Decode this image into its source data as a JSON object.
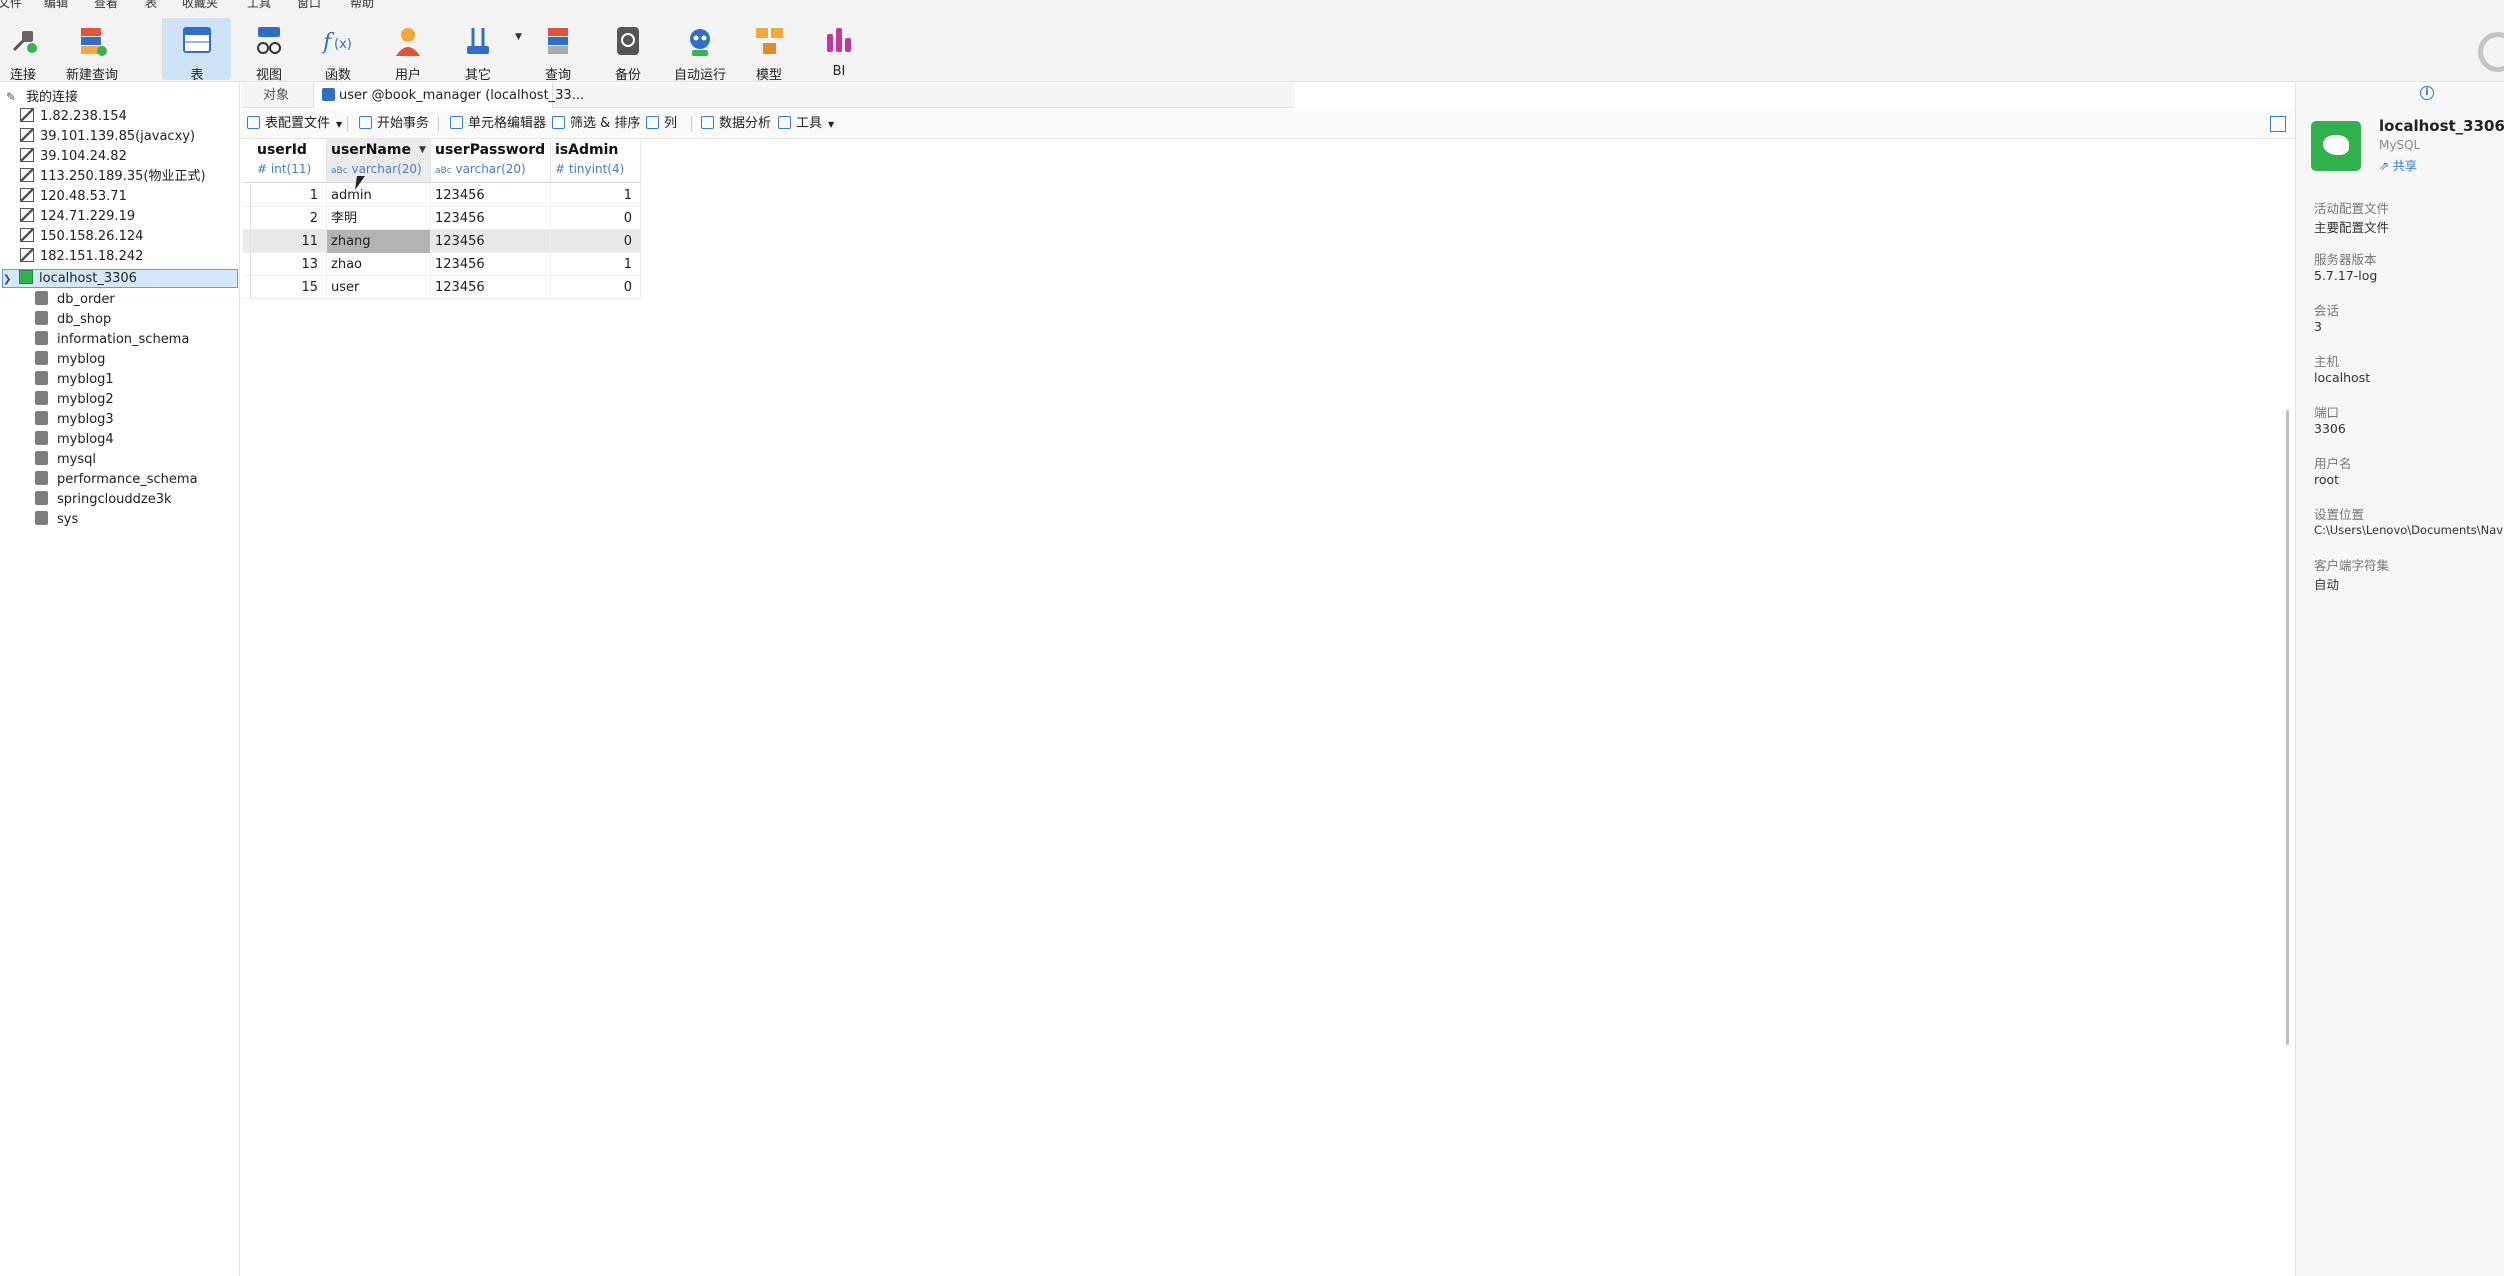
{
  "menu": [
    "文件",
    "编辑",
    "查看",
    "表",
    "收藏夹",
    "工具",
    "窗口",
    "帮助"
  ],
  "toolbar": [
    {
      "label": "连接",
      "icon": "plug-icon"
    },
    {
      "label": "新建查询",
      "icon": "new-query-icon"
    },
    {
      "label": "表",
      "icon": "table-icon"
    },
    {
      "label": "视图",
      "icon": "view-glasses-icon"
    },
    {
      "label": "函数",
      "icon": "function-icon"
    },
    {
      "label": "用户",
      "icon": "user-icon"
    },
    {
      "label": "其它",
      "icon": "tools-icon"
    },
    {
      "label": "查询",
      "icon": "query-icon"
    },
    {
      "label": "备份",
      "icon": "backup-icon"
    },
    {
      "label": "自动运行",
      "icon": "robot-icon"
    },
    {
      "label": "模型",
      "icon": "model-icon"
    },
    {
      "label": "BI",
      "icon": "bi-chart-icon"
    }
  ],
  "colors": {
    "accent": "#2e75d1",
    "connection_green": "#31b14b",
    "active_toolbar": "#cfe3f7"
  },
  "navigator": {
    "root": "我的连接",
    "connections": [
      "1.82.238.154",
      "39.101.139.85(javacxy)",
      "39.104.24.82",
      "113.250.189.35(物业正式)",
      "120.48.53.71",
      "124.71.229.19",
      "150.158.26.124",
      "182.151.18.242"
    ],
    "active_connection": "localhost_3306",
    "databases": [
      "db_order",
      "db_shop",
      "information_schema",
      "myblog",
      "myblog1",
      "myblog2",
      "myblog3",
      "myblog4",
      "mysql",
      "performance_schema",
      "springclouddze3k",
      "sys"
    ]
  },
  "tabs": {
    "objects": "对象",
    "active": "user @book_manager (localhost_33..."
  },
  "subtoolbar": {
    "profile": "表配置文件",
    "begin_tx": "开始事务",
    "cell_editor": "单元格编辑器",
    "filter_sort": "筛选 & 排序",
    "columns": "列",
    "analysis": "数据分析",
    "tools": "工具"
  },
  "grid": {
    "columns": [
      {
        "name": "userId",
        "type": "int(11)",
        "type_icon": "#"
      },
      {
        "name": "userName",
        "type": "varchar(20)",
        "type_icon": "aBc"
      },
      {
        "name": "userPassword",
        "type": "varchar(20)",
        "type_icon": "aBc"
      },
      {
        "name": "isAdmin",
        "type": "tinyint(4)",
        "type_icon": "#"
      }
    ],
    "rows": [
      [
        "1",
        "admin",
        "123456",
        "1"
      ],
      [
        "2",
        "李明",
        "123456",
        "0"
      ],
      [
        "11",
        "zhang",
        "123456",
        "0"
      ],
      [
        "13",
        "zhao",
        "123456",
        "1"
      ],
      [
        "15",
        "user",
        "123456",
        "0"
      ]
    ]
  },
  "info": {
    "name": "localhost_3306",
    "type": "MySQL",
    "share": "共享",
    "fields": [
      {
        "label": "活动配置文件",
        "value": "主要配置文件"
      },
      {
        "label": "服务器版本",
        "value": "5.7.17-log"
      },
      {
        "label": "会话",
        "value": "3"
      },
      {
        "label": "主机",
        "value": "localhost"
      },
      {
        "label": "端口",
        "value": "3306"
      },
      {
        "label": "用户名",
        "value": "root"
      },
      {
        "label": "设置位置",
        "value": "C:\\Users\\Lenovo\\Documents\\Navicat"
      },
      {
        "label": "客户端字符集",
        "value": "自动"
      }
    ]
  }
}
